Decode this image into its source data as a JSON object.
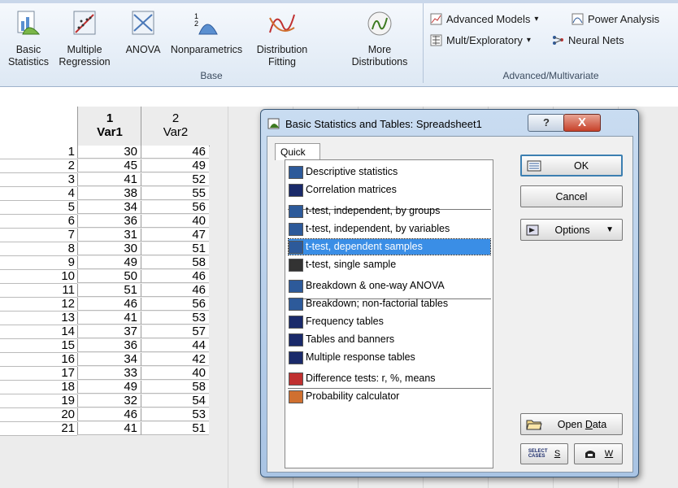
{
  "ribbon": {
    "base_buttons": [
      {
        "line1": "Basic",
        "line2": "Statistics",
        "icon": "basic-statistics-icon"
      },
      {
        "line1": "Multiple",
        "line2": "Regression",
        "icon": "multiple-regression-icon"
      },
      {
        "line1": "ANOVA",
        "line2": "",
        "icon": "anova-icon"
      },
      {
        "line1": "Nonparametrics",
        "line2": "",
        "icon": "nonparametrics-icon"
      },
      {
        "line1": "Distribution",
        "line2": "Fitting",
        "icon": "distribution-fitting-icon"
      },
      {
        "line1": "More",
        "line2": "Distributions",
        "icon": "more-distributions-icon"
      }
    ],
    "base_group_label": "Base",
    "advanced_items": [
      {
        "label": "Advanced Models",
        "dropdown": "▾"
      },
      {
        "label": "Power Analysis",
        "dropdown": ""
      },
      {
        "label": "Mult/Exploratory",
        "dropdown": "▾"
      },
      {
        "label": "Neural Nets",
        "dropdown": ""
      }
    ],
    "advanced_group_label": "Advanced/Multivariate"
  },
  "spreadsheet": {
    "columns": [
      {
        "num": "1",
        "name": "Var1"
      },
      {
        "num": "2",
        "name": "Var2"
      }
    ],
    "rows": [
      {
        "n": "1",
        "v1": "30",
        "v2": "46"
      },
      {
        "n": "2",
        "v1": "45",
        "v2": "49"
      },
      {
        "n": "3",
        "v1": "41",
        "v2": "52"
      },
      {
        "n": "4",
        "v1": "38",
        "v2": "55"
      },
      {
        "n": "5",
        "v1": "34",
        "v2": "56"
      },
      {
        "n": "6",
        "v1": "36",
        "v2": "40"
      },
      {
        "n": "7",
        "v1": "31",
        "v2": "47"
      },
      {
        "n": "8",
        "v1": "30",
        "v2": "51"
      },
      {
        "n": "9",
        "v1": "49",
        "v2": "58"
      },
      {
        "n": "10",
        "v1": "50",
        "v2": "46"
      },
      {
        "n": "11",
        "v1": "51",
        "v2": "46"
      },
      {
        "n": "12",
        "v1": "46",
        "v2": "56"
      },
      {
        "n": "13",
        "v1": "41",
        "v2": "53"
      },
      {
        "n": "14",
        "v1": "37",
        "v2": "57"
      },
      {
        "n": "15",
        "v1": "36",
        "v2": "44"
      },
      {
        "n": "16",
        "v1": "34",
        "v2": "42"
      },
      {
        "n": "17",
        "v1": "33",
        "v2": "40"
      },
      {
        "n": "18",
        "v1": "49",
        "v2": "58"
      },
      {
        "n": "19",
        "v1": "32",
        "v2": "54"
      },
      {
        "n": "20",
        "v1": "46",
        "v2": "53"
      },
      {
        "n": "21",
        "v1": "41",
        "v2": "51"
      }
    ]
  },
  "dialog": {
    "title": "Basic Statistics and Tables: Spreadsheet1",
    "help": "?",
    "close": "X",
    "tab": "Quick",
    "items": [
      {
        "label": "Descriptive statistics",
        "icon": "descriptive-statistics-icon",
        "selected": false
      },
      {
        "label": "Correlation matrices",
        "icon": "correlation-matrices-icon",
        "selected": false
      },
      {
        "label": "t-test, independent, by groups",
        "icon": "t-test-groups-icon",
        "selected": false
      },
      {
        "label": "t-test, independent, by variables",
        "icon": "t-test-variables-icon",
        "selected": false
      },
      {
        "label": "t-test, dependent samples",
        "icon": "t-test-dependent-icon",
        "selected": true
      },
      {
        "label": "t-test, single sample",
        "icon": "t-test-single-icon",
        "selected": false
      },
      {
        "label": "Breakdown & one-way ANOVA",
        "icon": "breakdown-anova-icon",
        "selected": false
      },
      {
        "label": "Breakdown; non-factorial tables",
        "icon": "breakdown-nonfactorial-icon",
        "selected": false
      },
      {
        "label": "Frequency tables",
        "icon": "frequency-tables-icon",
        "selected": false
      },
      {
        "label": "Tables and banners",
        "icon": "tables-banners-icon",
        "selected": false
      },
      {
        "label": "Multiple response tables",
        "icon": "multiple-response-icon",
        "selected": false
      },
      {
        "label": "Difference tests: r, %, means",
        "icon": "difference-tests-icon",
        "selected": false
      },
      {
        "label": "Probability calculator",
        "icon": "probability-calculator-icon",
        "selected": false
      }
    ],
    "buttons": {
      "ok": "OK",
      "cancel": "Cancel",
      "options": "Options",
      "open_data_prefix": "Open ",
      "open_data_mnemonic": "D",
      "open_data_suffix": "ata",
      "select_cases_icon_text": "SELECT CASES",
      "s_key": "S",
      "w_key": "W"
    }
  },
  "colors": {
    "selection": "#3a8ee6",
    "dialog_frame": "#a9c4e4",
    "ribbon": "#dde8f4"
  }
}
